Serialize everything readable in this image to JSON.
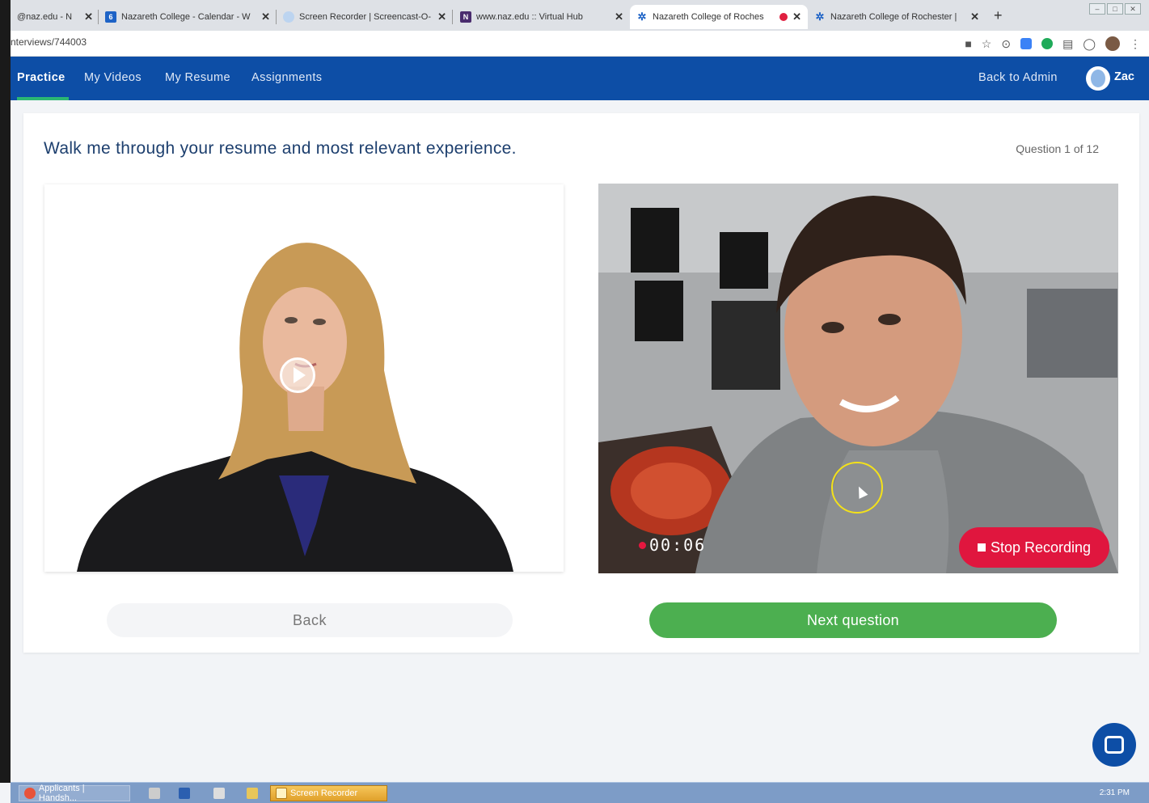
{
  "browser": {
    "tabs": [
      {
        "label": "@naz.edu - N",
        "favicon_color": "#dee1e6"
      },
      {
        "label": "Nazareth College - Calendar - W",
        "favicon_color": "#1e63c6",
        "favicon_text": "6"
      },
      {
        "label": "Screen Recorder | Screencast-O-",
        "favicon_color": "#bcd4f0"
      },
      {
        "label": "www.naz.edu :: Virtual Hub",
        "favicon_color": "#4a2c6e",
        "favicon_text": "N"
      },
      {
        "label": "Nazareth College of Roches",
        "favicon_color": "#ffffff",
        "active": true
      },
      {
        "label": "Nazareth College of Rochester | ",
        "favicon_color": "#ffffff"
      }
    ],
    "tab_close": "✕",
    "new_tab": "+",
    "url": "nterviews/744003"
  },
  "nav": {
    "links": [
      "Practice",
      "My Videos",
      "My Resume",
      "Assignments"
    ],
    "back_to_admin": "Back to Admin",
    "user": "Zac",
    "brand_color": "#0d4ea6",
    "accent_color": "#2bb673"
  },
  "interview": {
    "question": "Walk me through your resume and most relevant experience.",
    "question_count": "Question 1 of 12",
    "timer": "00:06",
    "stop_label": "Stop Recording",
    "back_label": "Back",
    "next_label": "Next question"
  },
  "taskbar": {
    "items": [
      "Applicants | Handsh...",
      "Screen Recorder"
    ],
    "clock": "2:31 PM"
  }
}
